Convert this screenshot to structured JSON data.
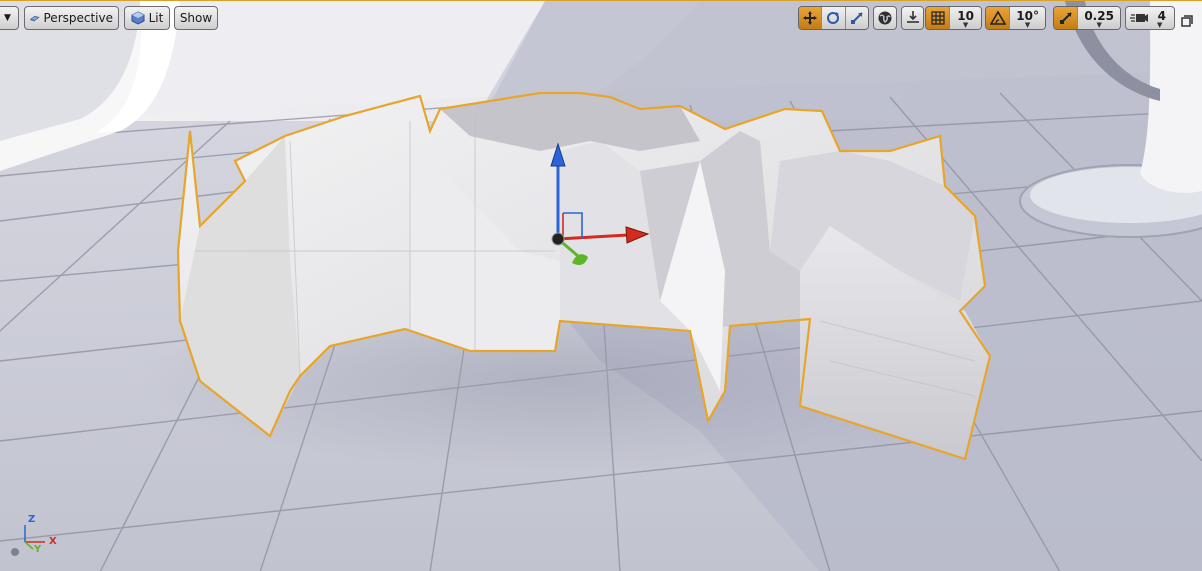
{
  "toolbar": {
    "perspective_label": "Perspective",
    "lit_label": "Lit",
    "show_label": "Show",
    "grid_snap_value": "10",
    "rotation_snap_value": "10°",
    "scale_snap_value": "0.25",
    "camera_speed_value": "4"
  },
  "axis_indicator": {
    "z": "Z",
    "y": "Y",
    "x": "X"
  },
  "colors": {
    "selection_outline": "#e7a52c",
    "active_toggle": "#d48b20",
    "x_axis": "#d42b1e",
    "y_axis": "#5fb52a",
    "z_axis": "#2b64d9"
  },
  "icons": [
    "viewport-options-icon",
    "perspective-cube-icon",
    "lit-sphere-icon",
    "translate-icon",
    "rotate-icon",
    "scale-icon",
    "world-space-icon",
    "surface-snap-icon",
    "grid-snap-icon",
    "rotation-snap-icon",
    "scale-snap-icon",
    "camera-speed-icon",
    "maximize-icon"
  ]
}
